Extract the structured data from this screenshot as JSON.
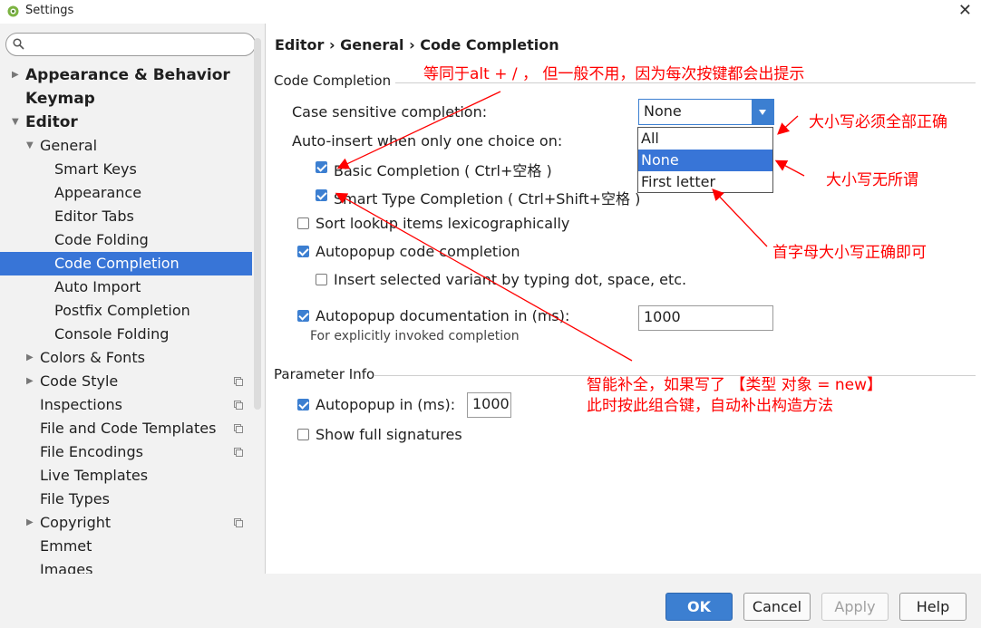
{
  "window": {
    "title": "Settings",
    "close_glyph": "✕"
  },
  "search": {
    "placeholder": "",
    "icon": "search-icon"
  },
  "sidebar": {
    "items": [
      {
        "label": "Appearance & Behavior",
        "level": 0,
        "bold": true,
        "arrow": "right"
      },
      {
        "label": "Keymap",
        "level": 0,
        "bold": true,
        "arrow": ""
      },
      {
        "label": "Editor",
        "level": 0,
        "bold": true,
        "arrow": "down"
      },
      {
        "label": "General",
        "level": 1,
        "bold": false,
        "arrow": "down"
      },
      {
        "label": "Smart Keys",
        "level": 2,
        "bold": false,
        "arrow": ""
      },
      {
        "label": "Appearance",
        "level": 2,
        "bold": false,
        "arrow": ""
      },
      {
        "label": "Editor Tabs",
        "level": 2,
        "bold": false,
        "arrow": ""
      },
      {
        "label": "Code Folding",
        "level": 2,
        "bold": false,
        "arrow": ""
      },
      {
        "label": "Code Completion",
        "level": 2,
        "bold": false,
        "arrow": "",
        "selected": true
      },
      {
        "label": "Auto Import",
        "level": 2,
        "bold": false,
        "arrow": ""
      },
      {
        "label": "Postfix Completion",
        "level": 2,
        "bold": false,
        "arrow": ""
      },
      {
        "label": "Console Folding",
        "level": 2,
        "bold": false,
        "arrow": ""
      },
      {
        "label": "Colors & Fonts",
        "level": 1,
        "bold": false,
        "arrow": "right"
      },
      {
        "label": "Code Style",
        "level": 1,
        "bold": false,
        "arrow": "right",
        "project_icon": true
      },
      {
        "label": "Inspections",
        "level": 1,
        "bold": false,
        "arrow": "",
        "project_icon": true
      },
      {
        "label": "File and Code Templates",
        "level": 1,
        "bold": false,
        "arrow": "",
        "project_icon": true
      },
      {
        "label": "File Encodings",
        "level": 1,
        "bold": false,
        "arrow": "",
        "project_icon": true
      },
      {
        "label": "Live Templates",
        "level": 1,
        "bold": false,
        "arrow": ""
      },
      {
        "label": "File Types",
        "level": 1,
        "bold": false,
        "arrow": ""
      },
      {
        "label": "Copyright",
        "level": 1,
        "bold": false,
        "arrow": "right",
        "project_icon": true
      },
      {
        "label": "Emmet",
        "level": 1,
        "bold": false,
        "arrow": ""
      },
      {
        "label": "Images",
        "level": 1,
        "bold": false,
        "arrow": ""
      }
    ]
  },
  "main": {
    "breadcrumb": "Editor › General › Code Completion",
    "code_completion": {
      "section_title": "Code Completion",
      "case_sensitive_label": "Case sensitive completion:",
      "case_sensitive_value": "None",
      "dropdown_options": [
        "All",
        "None",
        "First letter"
      ],
      "dropdown_selected": "None",
      "auto_insert_label": "Auto-insert when only one choice on:",
      "basic_completion": {
        "label": "Basic Completion ( Ctrl+空格 )",
        "checked": true
      },
      "smart_type_completion": {
        "label": "Smart Type Completion ( Ctrl+Shift+空格 )",
        "checked": true
      },
      "sort_lookup": {
        "label": "Sort lookup items lexicographically",
        "checked": false
      },
      "autopopup_code": {
        "label": "Autopopup code completion",
        "checked": true
      },
      "insert_selected": {
        "label": "Insert selected variant by typing dot, space, etc.",
        "checked": false
      },
      "autopopup_doc": {
        "label": "Autopopup documentation in (ms):",
        "checked": true,
        "value": "1000"
      },
      "autopopup_doc_hint": "For explicitly invoked completion"
    },
    "parameter_info": {
      "section_title": "Parameter Info",
      "autopopup_in": {
        "label": "Autopopup in (ms):",
        "checked": true,
        "value": "1000"
      },
      "show_full_signatures": {
        "label": "Show full signatures",
        "checked": false
      }
    }
  },
  "footer": {
    "ok": "OK",
    "cancel": "Cancel",
    "apply": "Apply",
    "help": "Help"
  },
  "annotations": {
    "top": "等同于alt + / ， 但一般不用，因为每次按键都会出提示",
    "all": "大小写必须全部正确",
    "none": "大小写无所谓",
    "first_letter": "首字母大小写正确即可",
    "smart_line1": "智能补全，如果写了 【类型 对象 = new】",
    "smart_line2": "此时按此组合键，自动补出构造方法"
  },
  "colors": {
    "accent": "#3c7fd1",
    "selection": "#3875d7",
    "annotation": "#ff0000"
  }
}
